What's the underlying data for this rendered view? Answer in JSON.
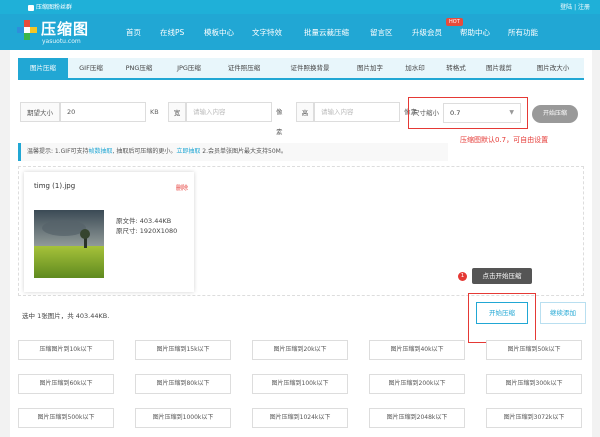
{
  "topstrip": {
    "qq_group": "压缩图粉丝群",
    "login": "登陆 | 注册"
  },
  "header": {
    "logo_title": "压缩图",
    "logo_sub": "yasuotu.com",
    "nav": [
      "首页",
      "在线PS",
      "模板中心",
      "文字特效",
      "批量云裁压缩",
      "留言区",
      "升级会员",
      "帮助中心",
      "所有功能"
    ],
    "hot_badge": "HOT"
  },
  "tabs": [
    "图片压缩",
    "GIF压缩",
    "PNG压缩",
    "JPG压缩",
    "证件照压缩",
    "证件照换背景",
    "图片加字",
    "加水印",
    "转格式",
    "图片裁剪",
    "图片改大小"
  ],
  "form": {
    "size_label": "期望大小",
    "size_value": "20",
    "size_unit": "KB",
    "width_label": "宽",
    "width_placeholder": "请输入内容",
    "px_unit": "像素",
    "height_label": "高",
    "height_placeholder": "请输入内容",
    "ratio_label": "尺寸缩小",
    "ratio_value": "0.7",
    "start_label": "开始压缩"
  },
  "annotations": {
    "default_note": "压缩图默认0.7，可自由设置",
    "step_number": "1",
    "step_text": "点击开始压缩"
  },
  "tip": {
    "prefix": "温馨提示: 1.GIF可支持",
    "link1": "帧数抽取",
    "middle": ", 抽取后可压缩的更小。",
    "link2": "立即抽取",
    "suffix": " 2.会员单张图片最大支持50M。"
  },
  "file": {
    "name": "timg (1).jpg",
    "delete": "删除",
    "original_size": "原文件: 403.44KB",
    "original_dims": "原尺寸: 1920X1080"
  },
  "selection_summary": "选中 1张图片，共 403.44KB.",
  "buttons": {
    "start": "开始压缩",
    "continue_add": "继续添加"
  },
  "presets": [
    "压缩图片到10k以下",
    "图片压缩到15k以下",
    "图片压缩到20k以下",
    "图片压缩到40k以下",
    "图片压缩到50k以下",
    "图片压缩到60k以下",
    "图片压缩到80k以下",
    "图片压缩到100k以下",
    "图片压缩到200k以下",
    "图片压缩到300k以下",
    "图片压缩到500k以下",
    "图片压缩到1000k以下",
    "图片压缩到1024k以下",
    "图片压缩到2048k以下",
    "图片压缩到3072k以下"
  ],
  "colors": {
    "brand": "#21a7d4",
    "accent_red": "#e53935"
  }
}
